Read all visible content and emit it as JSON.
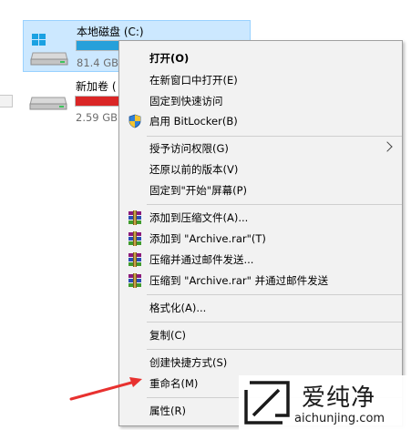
{
  "drives": [
    {
      "name": "本地磁盘 (C:)",
      "size_text": "81.4 GB",
      "usage_fraction": 0.85,
      "bar_color": "#26a0da",
      "selected": true
    },
    {
      "name": "新加卷 (",
      "size_text": "2.59 GB",
      "usage_fraction": 0.9,
      "bar_color": "#da2626",
      "selected": false
    }
  ],
  "context_menu": {
    "items": [
      {
        "label": "打开(O)",
        "bold": true
      },
      {
        "label": "在新窗口中打开(E)"
      },
      {
        "label": "固定到快速访问"
      },
      {
        "label": "启用 BitLocker(B)",
        "icon": "shield-icon"
      },
      {
        "label": "授予访问权限(G)",
        "submenu": true
      },
      {
        "label": "还原以前的版本(V)"
      },
      {
        "label": "固定到\"开始\"屏幕(P)"
      },
      {
        "label": "添加到压缩文件(A)...",
        "icon": "winrar-icon"
      },
      {
        "label": "添加到 \"Archive.rar\"(T)",
        "icon": "winrar-icon"
      },
      {
        "label": "压缩并通过邮件发送...",
        "icon": "winrar-icon"
      },
      {
        "label": "压缩到 \"Archive.rar\" 并通过邮件发送",
        "icon": "winrar-icon"
      },
      {
        "label": "格式化(A)..."
      },
      {
        "label": "复制(C)"
      },
      {
        "label": "创建快捷方式(S)"
      },
      {
        "label": "重命名(M)"
      },
      {
        "label": "属性(R)"
      }
    ]
  },
  "annotation": {
    "color": "#e8312f"
  },
  "watermark": {
    "title": "爱纯净",
    "url": "aichunjing.com"
  }
}
